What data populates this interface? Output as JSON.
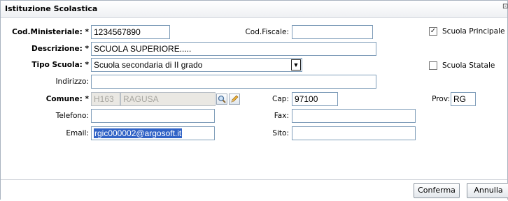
{
  "window": {
    "title": "Istituzione Scolastica"
  },
  "form": {
    "cod_ministeriale": {
      "label": "Cod.Ministeriale: *",
      "value": "1234567890"
    },
    "cod_fiscale": {
      "label": "Cod.Fiscale:",
      "value": ""
    },
    "scuola_principale": {
      "label": "Scuola Principale",
      "checked": true
    },
    "descrizione": {
      "label": "Descrizione: *",
      "value": "SCUOLA SUPERIORE....."
    },
    "tipo_scuola": {
      "label": "Tipo Scuola: *",
      "value": "Scuola secondaria di II grado"
    },
    "scuola_statale": {
      "label": "Scuola Statale",
      "checked": false
    },
    "indirizzo": {
      "label": "Indirizzo:",
      "value": ""
    },
    "comune": {
      "label": "Comune: *",
      "code": "H163",
      "name": "RAGUSA"
    },
    "cap": {
      "label": "Cap:",
      "value": "97100"
    },
    "prov": {
      "label": "Prov:",
      "value": "RG"
    },
    "telefono": {
      "label": "Telefono:",
      "value": ""
    },
    "fax": {
      "label": "Fax:",
      "value": ""
    },
    "email": {
      "label": "Email:",
      "value": "rgic000002@argosoft.it"
    },
    "sito": {
      "label": "Sito:",
      "value": ""
    }
  },
  "buttons": {
    "confirm": "Conferma",
    "cancel": "Annulla"
  },
  "icons": {
    "search": "magnifier-icon",
    "edit": "pencil-icon",
    "dropdown": "chevron-down-icon"
  }
}
